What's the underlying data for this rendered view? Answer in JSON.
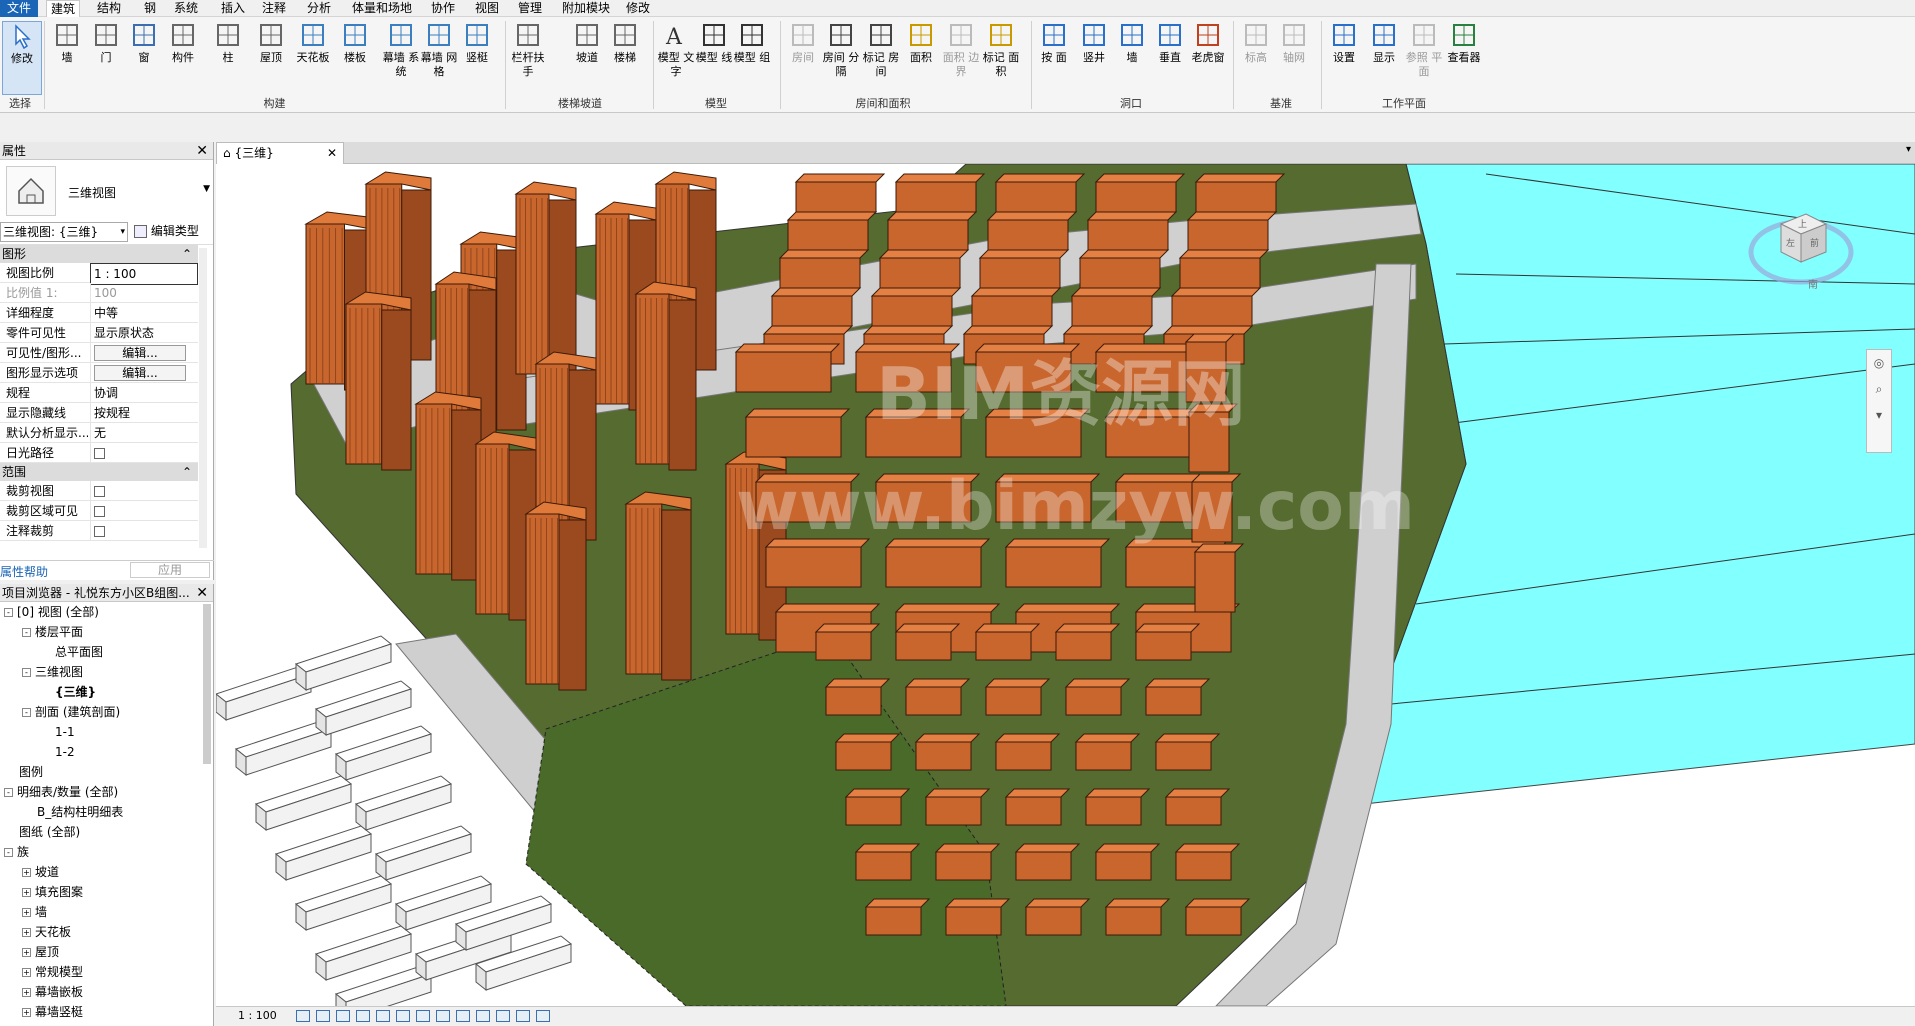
{
  "menu": [
    "文件",
    "建筑",
    "结构",
    "钢",
    "系统",
    "插入",
    "注释",
    "分析",
    "体量和场地",
    "协作",
    "视图",
    "管理",
    "附加模块",
    "修改"
  ],
  "ribbon": {
    "select_label": "选择",
    "buttons": [
      {
        "id": "modify",
        "label": "修改",
        "icon": "cursor-icon"
      },
      {
        "id": "wall",
        "label": "墙",
        "icon": "wall-icon"
      },
      {
        "id": "door",
        "label": "门",
        "icon": "door-icon"
      },
      {
        "id": "window",
        "label": "窗",
        "icon": "window-icon"
      },
      {
        "id": "component",
        "label": "构件",
        "icon": "component-icon"
      },
      {
        "id": "column",
        "label": "柱",
        "icon": "column-icon"
      },
      {
        "id": "roof",
        "label": "屋顶",
        "icon": "roof-icon"
      },
      {
        "id": "ceiling",
        "label": "天花板",
        "icon": "ceiling-icon"
      },
      {
        "id": "floor",
        "label": "楼板",
        "icon": "floor-icon"
      },
      {
        "id": "curtain_system",
        "label": "幕墙 系统",
        "icon": "curtain-system-icon"
      },
      {
        "id": "curtain_grid",
        "label": "幕墙 网格",
        "icon": "curtain-grid-icon"
      },
      {
        "id": "mullion",
        "label": "竖梃",
        "icon": "mullion-icon"
      },
      {
        "id": "railing",
        "label": "栏杆扶手",
        "icon": "railing-icon"
      },
      {
        "id": "ramp",
        "label": "坡道",
        "icon": "ramp-icon"
      },
      {
        "id": "stair",
        "label": "楼梯",
        "icon": "stair-icon"
      },
      {
        "id": "model_text",
        "label": "模型 文字",
        "icon": "model-text-icon"
      },
      {
        "id": "model_line",
        "label": "模型 线",
        "icon": "model-line-icon"
      },
      {
        "id": "model_group",
        "label": "模型 组",
        "icon": "model-group-icon"
      },
      {
        "id": "room",
        "label": "房间",
        "icon": "room-icon"
      },
      {
        "id": "room_sep",
        "label": "房间 分隔",
        "icon": "room-separator-icon"
      },
      {
        "id": "tag_room",
        "label": "标记 房间",
        "icon": "tag-room-icon"
      },
      {
        "id": "area",
        "label": "面积",
        "icon": "area-icon"
      },
      {
        "id": "area_boundary",
        "label": "面积 边界",
        "icon": "area-boundary-icon"
      },
      {
        "id": "tag_area",
        "label": "标记 面积",
        "icon": "tag-area-icon"
      },
      {
        "id": "by_face",
        "label": "按 面",
        "icon": "opening-by-face-icon"
      },
      {
        "id": "shaft",
        "label": "竖井",
        "icon": "shaft-icon"
      },
      {
        "id": "wall_opening",
        "label": "墙",
        "icon": "wall-opening-icon"
      },
      {
        "id": "vertical",
        "label": "垂直",
        "icon": "vertical-opening-icon"
      },
      {
        "id": "dormer",
        "label": "老虎窗",
        "icon": "dormer-icon"
      },
      {
        "id": "level",
        "label": "标高",
        "icon": "level-icon"
      },
      {
        "id": "grid",
        "label": "轴网",
        "icon": "grid-icon"
      },
      {
        "id": "set",
        "label": "设置",
        "icon": "set-workplane-icon"
      },
      {
        "id": "show",
        "label": "显示",
        "icon": "show-workplane-icon"
      },
      {
        "id": "ref_plane",
        "label": "参照 平面",
        "icon": "reference-plane-icon"
      },
      {
        "id": "viewer",
        "label": "查看器",
        "icon": "viewer-icon"
      }
    ],
    "groups": [
      "构建",
      "楼梯坡道",
      "模型",
      "房间和面积",
      "洞口",
      "基准",
      "工作平面"
    ]
  },
  "properties": {
    "title": "属性",
    "type_name": "三维视图",
    "instance_selector": "三维视图: {三维}",
    "edit_type": "编辑类型",
    "sections": {
      "graphics": "图形",
      "extents": "范围"
    },
    "rows": [
      {
        "k": "视图比例",
        "v": "1 : 100"
      },
      {
        "k": "比例值 1:",
        "v": "100"
      },
      {
        "k": "详细程度",
        "v": "中等"
      },
      {
        "k": "零件可见性",
        "v": "显示原状态"
      },
      {
        "k": "可见性/图形...",
        "v": "编辑..."
      },
      {
        "k": "图形显示选项",
        "v": "编辑..."
      },
      {
        "k": "规程",
        "v": "协调"
      },
      {
        "k": "显示隐藏线",
        "v": "按规程"
      },
      {
        "k": "默认分析显示...",
        "v": "无"
      },
      {
        "k": "日光路径",
        "v": ""
      },
      {
        "k": "裁剪视图",
        "v": ""
      },
      {
        "k": "裁剪区域可见",
        "v": ""
      },
      {
        "k": "注释裁剪",
        "v": ""
      }
    ],
    "help": "属性帮助",
    "apply": "应用"
  },
  "browser": {
    "title": "项目浏览器 - 礼悦东方小区B组图...",
    "items": [
      {
        "label": "[0] 视图 (全部)",
        "depth": 0,
        "tog": "-"
      },
      {
        "label": "楼层平面",
        "depth": 1,
        "tog": "-"
      },
      {
        "label": "总平面图",
        "depth": 2,
        "tog": ""
      },
      {
        "label": "三维视图",
        "depth": 1,
        "tog": "-"
      },
      {
        "label": "{三维}",
        "depth": 2,
        "tog": ""
      },
      {
        "label": "剖面 (建筑剖面)",
        "depth": 1,
        "tog": "-"
      },
      {
        "label": "1-1",
        "depth": 2,
        "tog": ""
      },
      {
        "label": "1-2",
        "depth": 2,
        "tog": ""
      },
      {
        "label": "图例",
        "depth": 0,
        "tog": ""
      },
      {
        "label": "明细表/数量 (全部)",
        "depth": 0,
        "tog": "-"
      },
      {
        "label": "B_结构柱明细表",
        "depth": 1,
        "tog": ""
      },
      {
        "label": "图纸 (全部)",
        "depth": 0,
        "tog": ""
      },
      {
        "label": "族",
        "depth": 0,
        "tog": "-"
      },
      {
        "label": "坡道",
        "depth": 1,
        "tog": "+"
      },
      {
        "label": "填充图案",
        "depth": 1,
        "tog": "+"
      },
      {
        "label": "墙",
        "depth": 1,
        "tog": "+"
      },
      {
        "label": "天花板",
        "depth": 1,
        "tog": "+"
      },
      {
        "label": "屋顶",
        "depth": 1,
        "tog": "+"
      },
      {
        "label": "常规模型",
        "depth": 1,
        "tog": "+"
      },
      {
        "label": "幕墙嵌板",
        "depth": 1,
        "tog": "+"
      },
      {
        "label": "幕墙竖梃",
        "depth": 1,
        "tog": "+"
      }
    ]
  },
  "view": {
    "tab_label": "{三维}",
    "watermark_line1": "BIM资源网",
    "watermark_line2": "www.bimzyw.com",
    "viewcube_faces": {
      "left": "左",
      "front": "前",
      "top": "上",
      "south": "南"
    }
  },
  "status": {
    "scale": "1 : 100"
  },
  "colors": {
    "water": "#82ffff",
    "ground": "#556b2f",
    "building": "#c8662e",
    "road": "#d6d6d6",
    "accent": "#1a65b6"
  }
}
